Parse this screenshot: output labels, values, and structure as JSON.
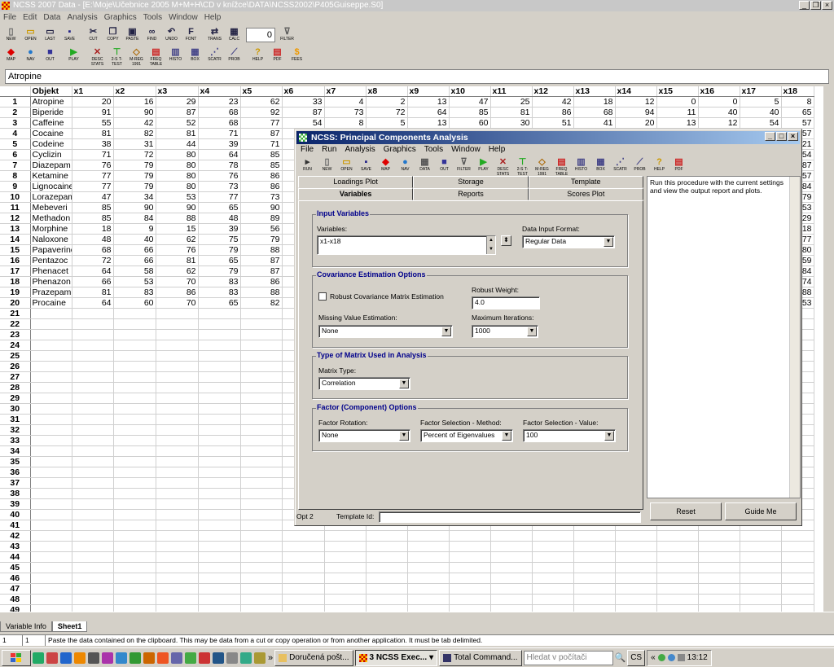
{
  "window": {
    "title": "NCSS 2007 Data - [E:\\Moje\\Učebnice 2005 M+M+H\\CD v knížce\\DATA\\NCSS2002\\P405Guiseppe.S0]"
  },
  "menu": [
    "File",
    "Edit",
    "Data",
    "Analysis",
    "Graphics",
    "Tools",
    "Window",
    "Help"
  ],
  "toolbar1": [
    {
      "label": "NEW",
      "icon": "new-file-icon"
    },
    {
      "label": "OPEN",
      "icon": "open-folder-icon"
    },
    {
      "label": "LAST",
      "icon": "last-icon"
    },
    {
      "label": "SAVE",
      "icon": "save-disk-icon"
    },
    {
      "label": "CUT",
      "icon": "scissors-icon"
    },
    {
      "label": "COPY",
      "icon": "copy-icon"
    },
    {
      "label": "PASTE",
      "icon": "paste-icon"
    },
    {
      "label": "FIND",
      "icon": "binoculars-icon"
    },
    {
      "label": "UNDO",
      "icon": "undo-icon"
    },
    {
      "label": "FONT",
      "icon": "font-icon"
    },
    {
      "label": "TRANS",
      "icon": "transform-icon"
    },
    {
      "label": "CALC",
      "icon": "calculator-icon"
    }
  ],
  "calc_value": "0",
  "filter_label": "FILTER",
  "toolbar2": [
    {
      "label": "MAP",
      "icon": "diamond-icon"
    },
    {
      "label": "NAV",
      "icon": "globe-icon"
    },
    {
      "label": "OUT",
      "icon": "output-icon"
    },
    {
      "label": "PLAY",
      "icon": "play-icon"
    },
    {
      "label": "DESC STATS",
      "icon": "desc-stats-icon"
    },
    {
      "label": "2-S T-TEST",
      "icon": "t-test-icon"
    },
    {
      "label": "M-REG 1991",
      "icon": "mreg-icon"
    },
    {
      "label": "FREQ TABLE",
      "icon": "freq-table-icon"
    },
    {
      "label": "HISTO",
      "icon": "histogram-icon"
    },
    {
      "label": "BOX",
      "icon": "box-plot-icon"
    },
    {
      "label": "SCATR",
      "icon": "scatter-icon"
    },
    {
      "label": "PROB",
      "icon": "prob-plot-icon"
    },
    {
      "label": "HELP",
      "icon": "help-icon"
    },
    {
      "label": "PDF",
      "icon": "pdf-icon"
    },
    {
      "label": "FEES",
      "icon": "fees-icon"
    }
  ],
  "cell_contents": "Atropine",
  "sheet": {
    "columns": [
      "Objekt",
      "x1",
      "x2",
      "x3",
      "x4",
      "x5",
      "x6",
      "x7",
      "x8",
      "x9",
      "x10",
      "x11",
      "x12",
      "x13",
      "x14",
      "x15",
      "x16",
      "x17",
      "x18"
    ],
    "rows": [
      [
        "Atropine",
        "20",
        "16",
        "29",
        "23",
        "62",
        "33",
        "4",
        "2",
        "13",
        "47",
        "25",
        "42",
        "18",
        "12",
        "0",
        "0",
        "5",
        "8"
      ],
      [
        "Biperide",
        "91",
        "90",
        "87",
        "68",
        "92",
        "87",
        "73",
        "72",
        "64",
        "85",
        "81",
        "86",
        "68",
        "94",
        "11",
        "40",
        "40",
        "65"
      ],
      [
        "Caffeine",
        "55",
        "42",
        "52",
        "68",
        "77",
        "54",
        "8",
        "5",
        "13",
        "60",
        "30",
        "51",
        "41",
        "20",
        "13",
        "12",
        "54",
        "57"
      ],
      [
        "Cocaine",
        "81",
        "82",
        "81",
        "71",
        "87",
        "",
        "",
        "",
        "",
        "",
        "",
        "",
        "",
        "",
        "",
        "",
        "",
        "57"
      ],
      [
        "Codeine",
        "38",
        "31",
        "44",
        "39",
        "71",
        "",
        "",
        "",
        "",
        "",
        "",
        "",
        "",
        "",
        "",
        "",
        "",
        "21"
      ],
      [
        "Cyclizin",
        "71",
        "72",
        "80",
        "64",
        "85",
        "",
        "",
        "",
        "",
        "",
        "",
        "",
        "",
        "",
        "",
        "",
        "",
        "54"
      ],
      [
        "Diazepam",
        "76",
        "79",
        "80",
        "78",
        "85",
        "",
        "",
        "",
        "",
        "",
        "",
        "",
        "",
        "",
        "",
        "",
        "",
        "87"
      ],
      [
        "Ketamine",
        "77",
        "79",
        "80",
        "76",
        "86",
        "",
        "",
        "",
        "",
        "",
        "",
        "",
        "",
        "",
        "",
        "",
        "",
        "57"
      ],
      [
        "Lignocaine",
        "77",
        "79",
        "80",
        "73",
        "86",
        "",
        "",
        "",
        "",
        "",
        "",
        "",
        "",
        "",
        "",
        "",
        "",
        "84"
      ],
      [
        "Lorazepam",
        "47",
        "34",
        "53",
        "77",
        "73",
        "",
        "",
        "",
        "",
        "",
        "",
        "",
        "",
        "",
        "",
        "",
        "",
        "79"
      ],
      [
        "Mebeveri",
        "85",
        "90",
        "90",
        "65",
        "90",
        "",
        "",
        "",
        "",
        "",
        "",
        "",
        "",
        "",
        "",
        "",
        "",
        "53"
      ],
      [
        "Methadon",
        "85",
        "84",
        "88",
        "48",
        "89",
        "",
        "",
        "",
        "",
        "",
        "",
        "",
        "",
        "",
        "",
        "",
        "",
        "29"
      ],
      [
        "Morphine",
        "18",
        "9",
        "15",
        "39",
        "56",
        "",
        "",
        "",
        "",
        "",
        "",
        "",
        "",
        "",
        "",
        "",
        "",
        "18"
      ],
      [
        "Naloxone",
        "48",
        "40",
        "62",
        "75",
        "79",
        "",
        "",
        "",
        "",
        "",
        "",
        "",
        "",
        "",
        "",
        "",
        "",
        "77"
      ],
      [
        "Papaverine",
        "68",
        "66",
        "76",
        "79",
        "88",
        "",
        "",
        "",
        "",
        "",
        "",
        "",
        "",
        "",
        "",
        "",
        "",
        "80"
      ],
      [
        "Pentazoc",
        "72",
        "66",
        "81",
        "65",
        "87",
        "",
        "",
        "",
        "",
        "",
        "",
        "",
        "",
        "",
        "",
        "",
        "",
        "59"
      ],
      [
        "Phenacet",
        "64",
        "58",
        "62",
        "79",
        "87",
        "",
        "",
        "",
        "",
        "",
        "",
        "",
        "",
        "",
        "",
        "",
        "",
        "84"
      ],
      [
        "Phenazon",
        "66",
        "53",
        "70",
        "83",
        "86",
        "",
        "",
        "",
        "",
        "",
        "",
        "",
        "",
        "",
        "",
        "",
        "",
        "74"
      ],
      [
        "Prazepam",
        "81",
        "83",
        "86",
        "83",
        "88",
        "",
        "",
        "",
        "",
        "",
        "",
        "",
        "",
        "",
        "",
        "",
        "",
        "88"
      ],
      [
        "Procaine",
        "64",
        "60",
        "70",
        "65",
        "82",
        "",
        "",
        "",
        "",
        "",
        "",
        "",
        "",
        "",
        "",
        "",
        "",
        "53"
      ]
    ],
    "row_count": 49
  },
  "sheet_tabs": [
    "Variable Info",
    "Sheet1"
  ],
  "status": {
    "row": "1",
    "col": "1",
    "message": "Paste the data contained on the clipboard. This may be data from a cut or copy operation or from another application. It must be tab delimited."
  },
  "dialog": {
    "title": "NCSS: Principal Components Analysis",
    "menu": [
      "File",
      "Run",
      "Analysis",
      "Graphics",
      "Tools",
      "Window",
      "Help"
    ],
    "toolbar": [
      {
        "label": "RUN",
        "icon": "run-icon"
      },
      {
        "label": "NEW",
        "icon": "new-file-icon"
      },
      {
        "label": "OPEN",
        "icon": "open-folder-icon"
      },
      {
        "label": "SAVE",
        "icon": "save-disk-icon"
      },
      {
        "label": "MAP",
        "icon": "diamond-icon"
      },
      {
        "label": "NAV",
        "icon": "globe-icon"
      },
      {
        "label": "DATA",
        "icon": "data-icon"
      },
      {
        "label": "OUT",
        "icon": "output-icon"
      },
      {
        "label": "FILTER",
        "icon": "filter-icon"
      },
      {
        "label": "PLAY",
        "icon": "play-icon"
      },
      {
        "label": "DESC STATS",
        "icon": "desc-stats-icon"
      },
      {
        "label": "2-S T-TEST",
        "icon": "t-test-icon"
      },
      {
        "label": "M-REG 1991",
        "icon": "mreg-icon"
      },
      {
        "label": "FREQ TABLE",
        "icon": "freq-table-icon"
      },
      {
        "label": "HISTO",
        "icon": "histogram-icon"
      },
      {
        "label": "BOX",
        "icon": "box-plot-icon"
      },
      {
        "label": "SCATR",
        "icon": "scatter-icon"
      },
      {
        "label": "PROB",
        "icon": "prob-plot-icon"
      },
      {
        "label": "HELP",
        "icon": "help-icon"
      },
      {
        "label": "PDF",
        "icon": "pdf-icon"
      }
    ],
    "tabs_top": [
      "Loadings Plot",
      "Storage",
      "Template"
    ],
    "tabs_bottom": [
      "Variables",
      "Reports",
      "Scores Plot"
    ],
    "input_variables": {
      "title": "Input Variables",
      "variables_label": "Variables:",
      "variables_value": "x1-x18",
      "format_label": "Data Input Format:",
      "format_value": "Regular Data"
    },
    "covariance": {
      "title": "Covariance Estimation Options",
      "robust_label": "Robust Covariance Matrix Estimation",
      "robust_weight_label": "Robust Weight:",
      "robust_weight_value": "4.0",
      "missing_label": "Missing Value Estimation:",
      "missing_value": "None",
      "max_iter_label": "Maximum Iterations:",
      "max_iter_value": "1000"
    },
    "matrix": {
      "title": "Type of Matrix Used in Analysis",
      "type_label": "Matrix Type:",
      "type_value": "Correlation"
    },
    "factor": {
      "title": "Factor (Component) Options",
      "rotation_label": "Factor Rotation:",
      "rotation_value": "None",
      "method_label": "Factor Selection - Method:",
      "method_value": "Percent of Eigenvalues",
      "value_label": "Factor Selection - Value:",
      "value_value": "100"
    },
    "help_text": "Run this procedure with the current settings and view the output report and plots.",
    "reset_label": "Reset",
    "guide_label": "Guide Me",
    "opt_label": "Opt 2",
    "template_label": "Template Id:"
  },
  "taskbar": {
    "tasks": [
      "Doručená pošt...",
      "3 NCSS Exec...",
      "Total Command..."
    ],
    "search_placeholder": "Hledat v počítači",
    "lang": "CS",
    "clock": "13:12"
  }
}
